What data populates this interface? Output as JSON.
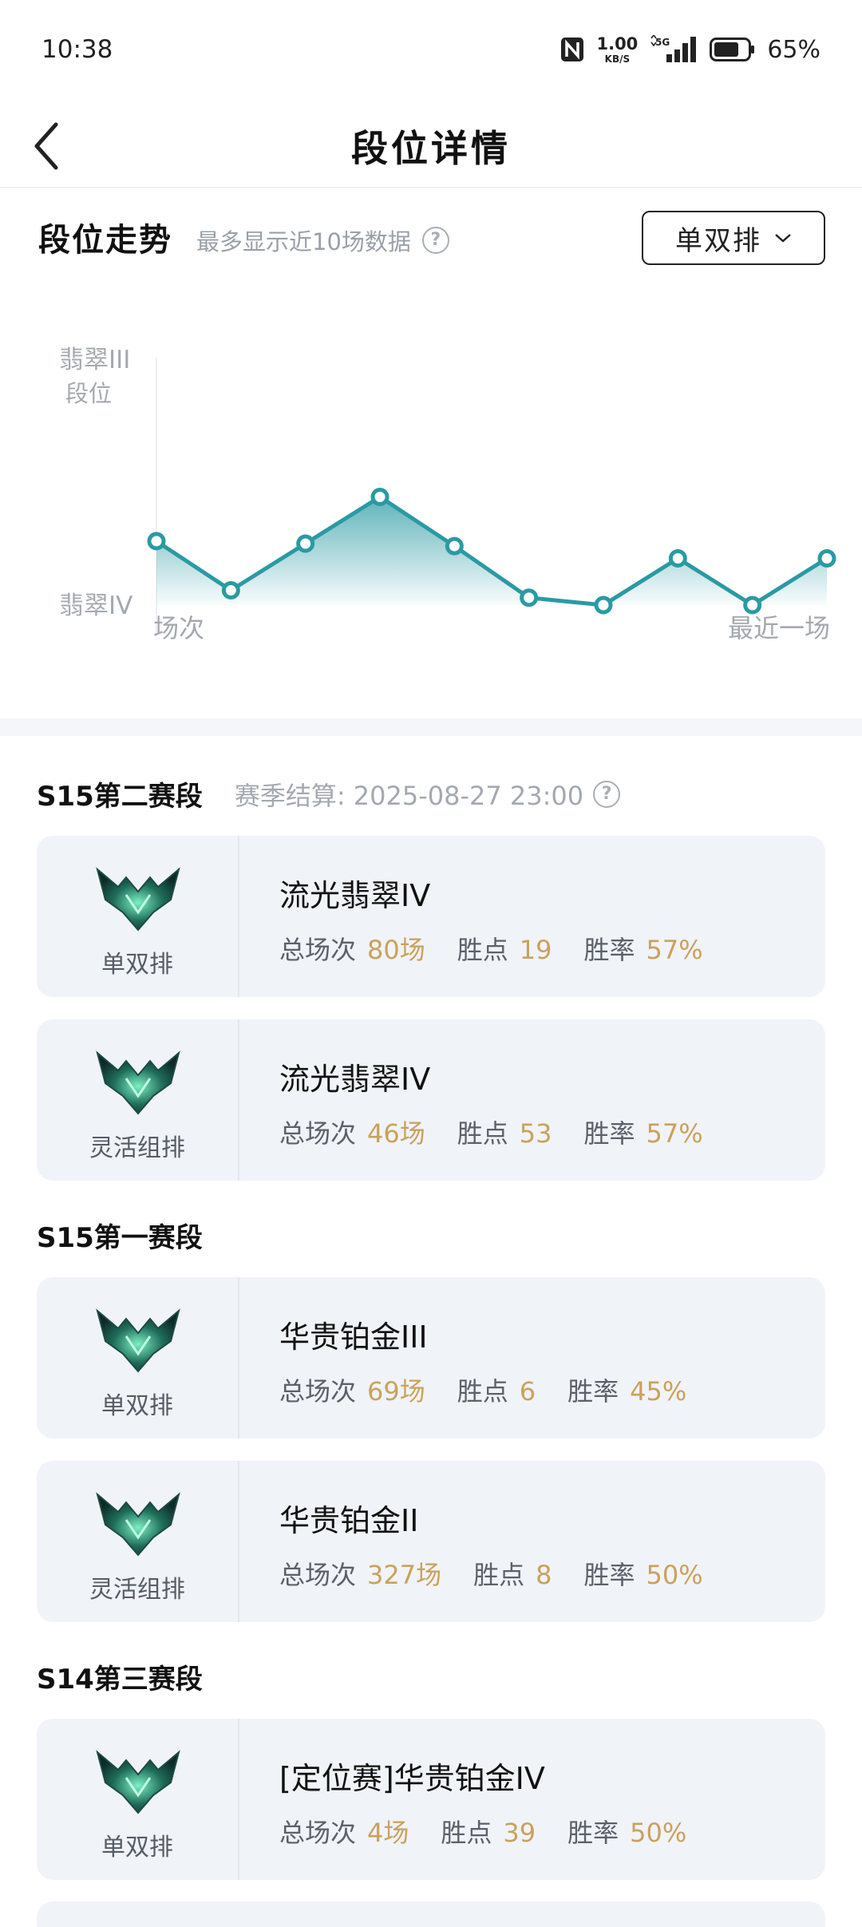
{
  "status_bar": {
    "time": "10:38",
    "net_speed_value": "1.00",
    "net_speed_unit": "KB/S",
    "network": "5G",
    "battery": "65%",
    "icons": [
      "nfc-icon",
      "signal-icon",
      "battery-icon"
    ]
  },
  "header": {
    "title": "段位详情",
    "back_icon": "chevron-left-icon"
  },
  "trend": {
    "title": "段位走势",
    "subtitle": "最多显示近10场数据",
    "queue_selected": "单双排"
  },
  "chart_data": {
    "type": "area",
    "ylabel": "段位",
    "xlabel_start": "场次",
    "xlabel_end": "最近一场",
    "y_ticks": [
      "翡翠III",
      "翡翠IV"
    ],
    "y_tick_values": [
      100,
      0
    ],
    "ylim": [
      0,
      100
    ],
    "x": [
      1,
      2,
      3,
      4,
      5,
      6,
      7,
      8,
      9,
      10
    ],
    "values": [
      26,
      6,
      25,
      44,
      24,
      3,
      0,
      19,
      0,
      19
    ],
    "color": "#2a9aa3",
    "grid": false
  },
  "seasons": [
    {
      "name": "S15第二赛段",
      "note": "赛季结算: 2025-08-27 23:00",
      "cards": [
        {
          "queue": "单双排",
          "rank": "流光翡翠IV",
          "games_label": "总场次",
          "games": "80场",
          "lp_label": "胜点",
          "lp": "19",
          "wr_label": "胜率",
          "wr": "57%"
        },
        {
          "queue": "灵活组排",
          "rank": "流光翡翠IV",
          "games_label": "总场次",
          "games": "46场",
          "lp_label": "胜点",
          "lp": "53",
          "wr_label": "胜率",
          "wr": "57%"
        }
      ]
    },
    {
      "name": "S15第一赛段",
      "cards": [
        {
          "queue": "单双排",
          "rank": "华贵铂金III",
          "games_label": "总场次",
          "games": "69场",
          "lp_label": "胜点",
          "lp": "6",
          "wr_label": "胜率",
          "wr": "45%"
        },
        {
          "queue": "灵活组排",
          "rank": "华贵铂金II",
          "games_label": "总场次",
          "games": "327场",
          "lp_label": "胜点",
          "lp": "8",
          "wr_label": "胜率",
          "wr": "50%"
        }
      ]
    },
    {
      "name": "S14第三赛段",
      "cards": [
        {
          "queue": "单双排",
          "rank": "[定位赛]华贵铂金IV",
          "games_label": "总场次",
          "games": "4场",
          "lp_label": "胜点",
          "lp": "39",
          "wr_label": "胜率",
          "wr": "50%"
        }
      ]
    }
  ],
  "colors": {
    "accent": "#2a9aa3",
    "stat_value": "#c9a25c",
    "card_bg": "#f0f3f8",
    "muted_text": "#a4a9b0"
  }
}
